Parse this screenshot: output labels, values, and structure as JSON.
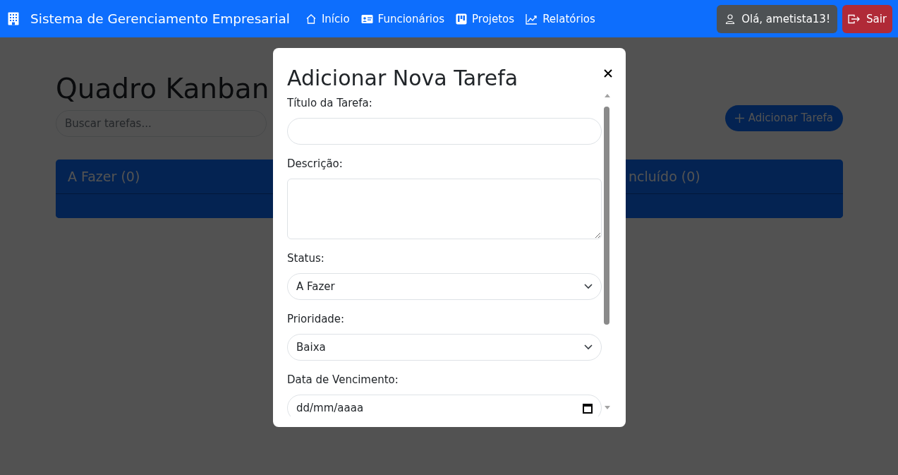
{
  "navbar": {
    "brand": "Sistema de Gerenciamento Empresarial",
    "links": [
      {
        "label": "Início",
        "kind": "home"
      },
      {
        "label": "Funcionários",
        "kind": "staff"
      },
      {
        "label": "Projetos",
        "kind": "projects"
      },
      {
        "label": "Relatórios",
        "kind": "reports"
      }
    ],
    "user_button": "Olá, ametista13!",
    "logout_button": "Sair"
  },
  "page": {
    "title": "Quadro Kanban",
    "search": {
      "placeholder": "Buscar tarefas..."
    },
    "add_button": "Adicionar Tarefa",
    "columns": [
      {
        "title": "A Fazer (0)"
      },
      {
        "title": "ncluído (0)"
      }
    ]
  },
  "modal": {
    "title": "Adicionar Nova Tarefa",
    "fields": [
      {
        "label": "Título da Tarefa:",
        "kind": "text"
      },
      {
        "label": "Descrição:",
        "kind": "textarea"
      },
      {
        "label": "Status:",
        "kind": "select",
        "value": "A Fazer"
      },
      {
        "label": "Prioridade:",
        "kind": "select",
        "value": "Baixa"
      },
      {
        "label": "Data de Vencimento:",
        "kind": "date",
        "value": "dd/mm/aaaa"
      }
    ]
  }
}
